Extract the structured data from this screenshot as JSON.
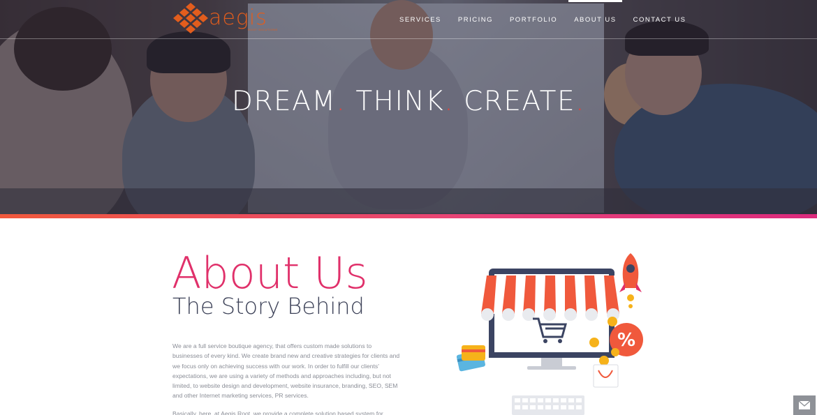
{
  "brand": {
    "logo_word": "aegis",
    "logo_tagline": "ROOT SOLUTIONS",
    "accent_color": "#e25d1d"
  },
  "nav": {
    "items": [
      {
        "label": "SERVICES",
        "active": false
      },
      {
        "label": "PRICING",
        "active": false
      },
      {
        "label": "PORTFOLIO",
        "active": false
      },
      {
        "label": "ABOUT US",
        "active": true
      },
      {
        "label": "CONTACT US",
        "active": false
      }
    ]
  },
  "hero": {
    "word1": "DREAM",
    "word2": "THINK",
    "word3": "CREATE",
    "dot": ".",
    "dot_color": "#e0433d"
  },
  "about": {
    "title": "About Us",
    "subtitle": "The Story Behind",
    "paragraph1": "We are a full service boutique agency, that offers custom made solutions to businesses of every kind. We create brand new and creative strategies for clients and we focus only on achieving success with our work. In order to fulfill our clients' expectations, we are using a variety of methods and approaches including, but not limited, to website design and development, website insurance, branding, SEO, SEM and other Internet marketing services, PR services.",
    "paragraph2": "Basically, here, at Aegis Root, we provide a complete solution based system for",
    "title_color": "#e0306a"
  },
  "icons": {
    "mail": "mail-icon",
    "illustration": "online-shop-illustration"
  }
}
